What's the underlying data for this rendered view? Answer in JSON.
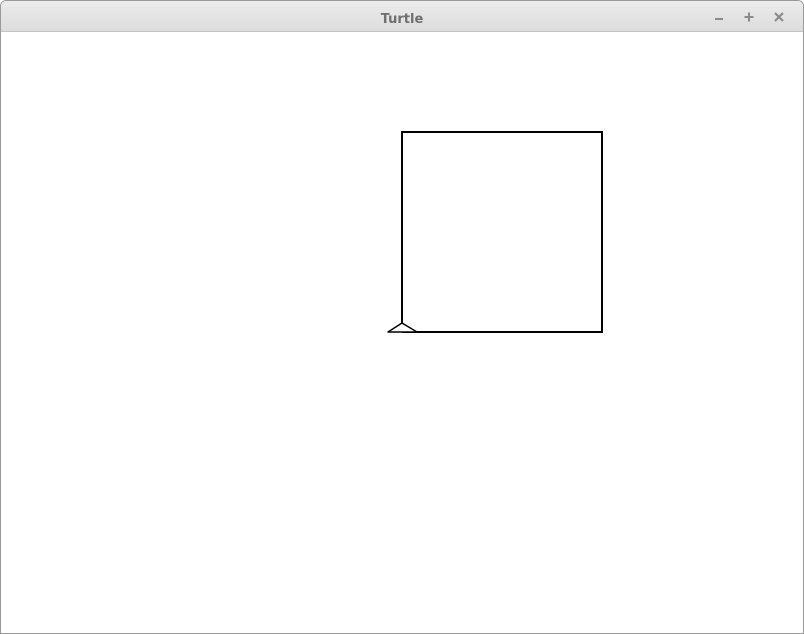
{
  "window": {
    "title": "Turtle"
  },
  "controls": {
    "minimize_icon": "minimize-icon",
    "maximize_icon": "maximize-icon",
    "close_icon": "close-icon"
  },
  "canvas": {
    "pen_color": "#000000",
    "background": "#ffffff"
  }
}
